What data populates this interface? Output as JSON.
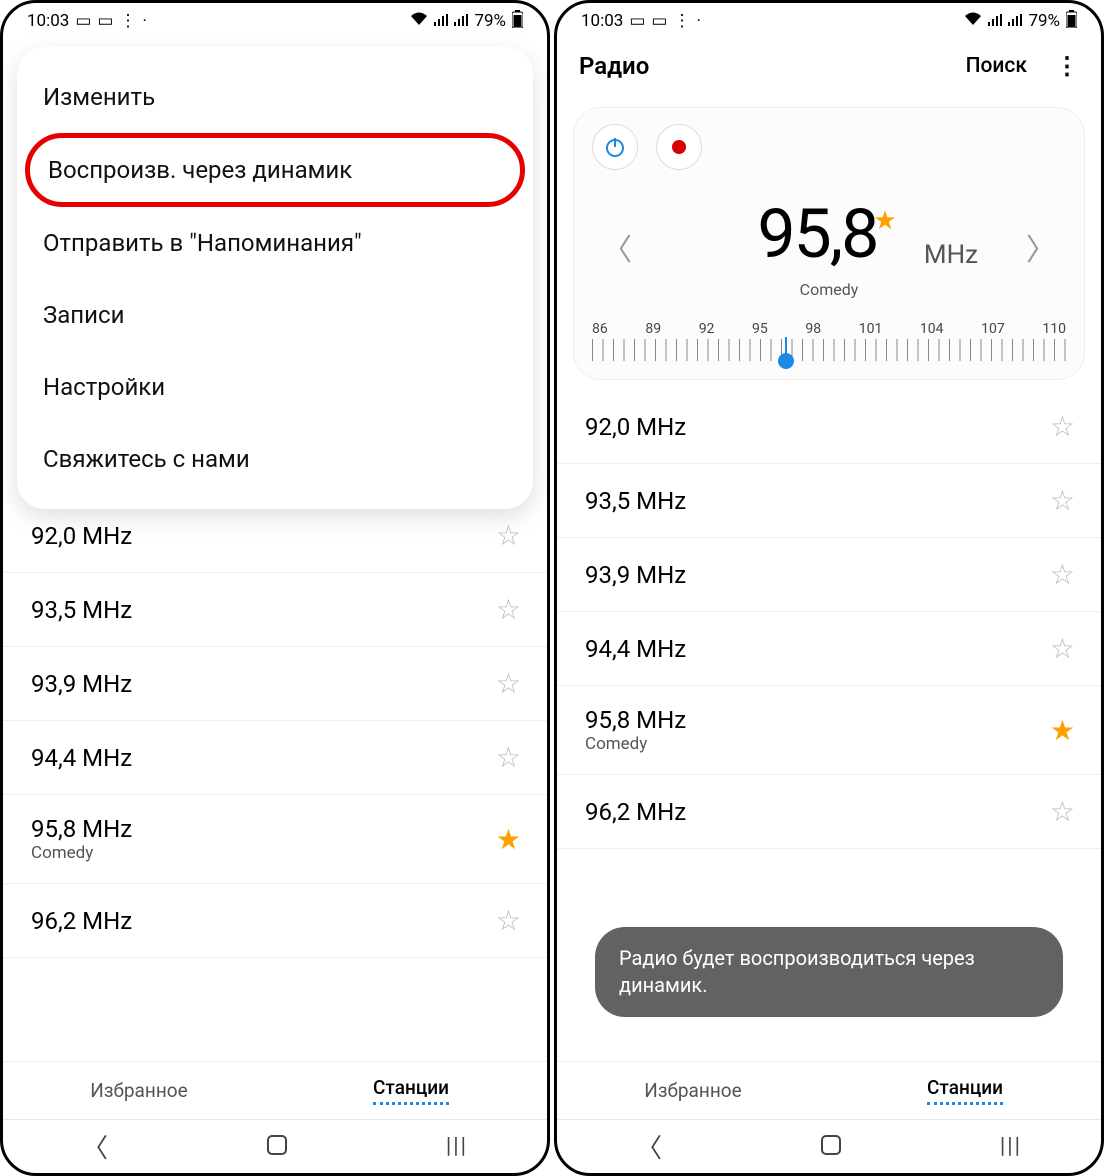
{
  "status": {
    "time": "10:03",
    "battery": "79%"
  },
  "left": {
    "menu": {
      "edit": "Изменить",
      "speaker": "Воспроизв. через динамик",
      "reminders": "Отправить в \"Напоминания\"",
      "recordings": "Записи",
      "settings": "Настройки",
      "contact": "Свяжитесь с нами"
    }
  },
  "right": {
    "title": "Радио",
    "search": "Поиск",
    "freq": "95,8",
    "unit": "MHz",
    "name": "Comedy",
    "scale": [
      "86",
      "89",
      "92",
      "95",
      "98",
      "101",
      "104",
      "107",
      "110"
    ],
    "toast": "Радио будет воспроизводиться через динамик."
  },
  "stations": [
    {
      "freq": "92,0 MHz",
      "name": "",
      "fav": false
    },
    {
      "freq": "93,5 MHz",
      "name": "",
      "fav": false
    },
    {
      "freq": "93,9 MHz",
      "name": "",
      "fav": false
    },
    {
      "freq": "94,4 MHz",
      "name": "",
      "fav": false
    },
    {
      "freq": "95,8 MHz",
      "name": "Comedy",
      "fav": true
    },
    {
      "freq": "96,2 MHz",
      "name": "",
      "fav": false
    }
  ],
  "tabs": {
    "fav": "Избранное",
    "stations": "Станции"
  }
}
